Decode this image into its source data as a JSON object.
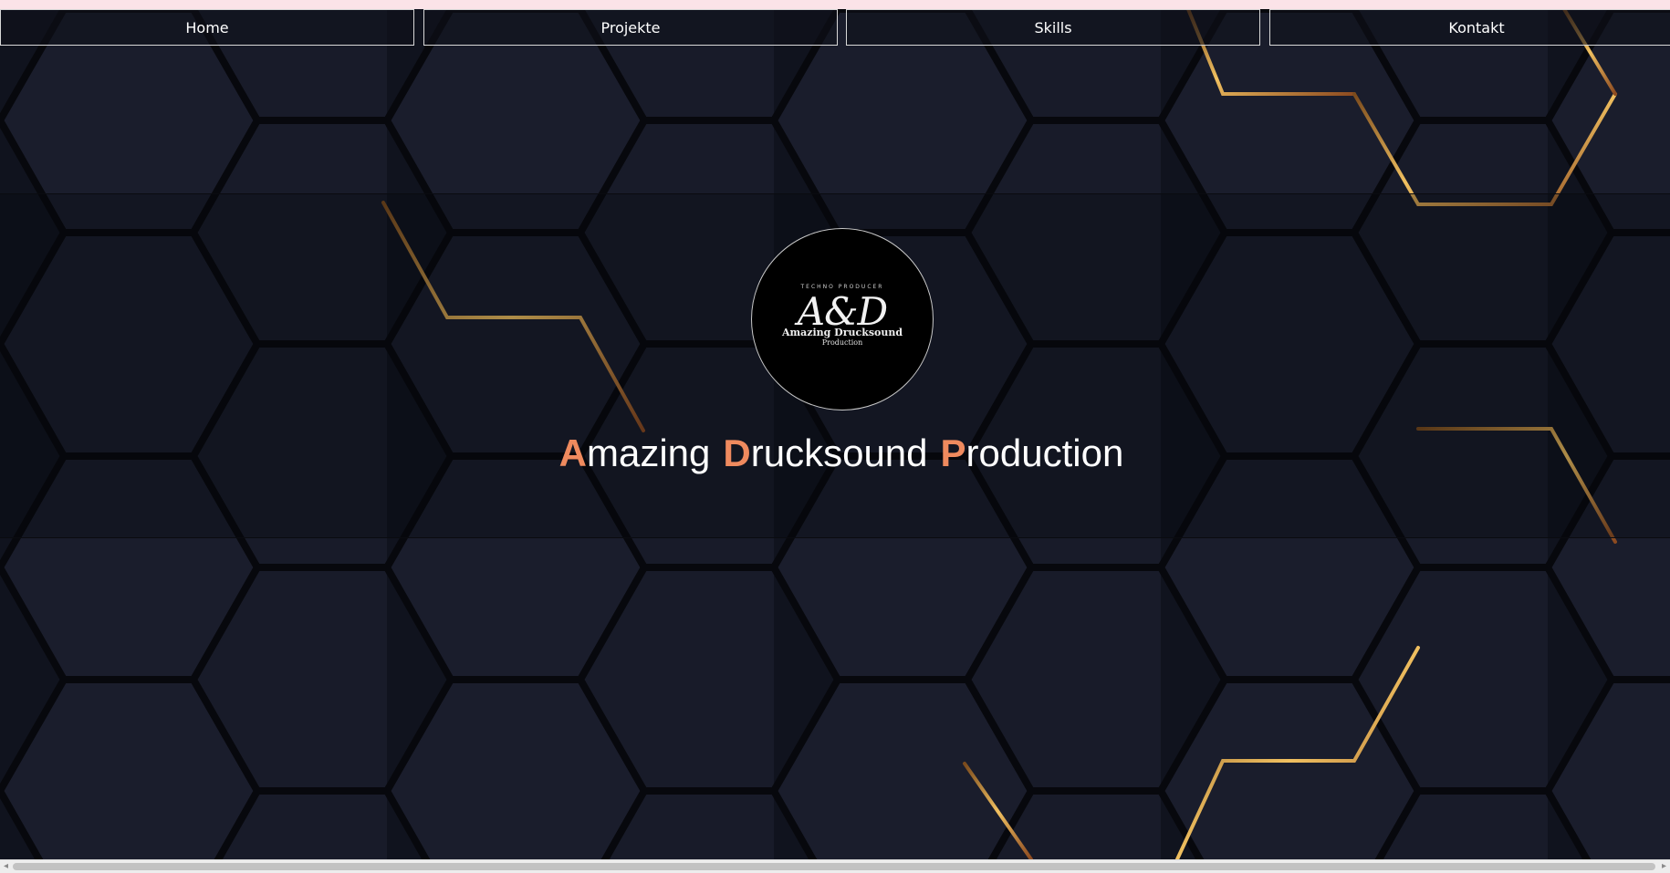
{
  "nav": {
    "items": [
      {
        "label": "Home"
      },
      {
        "label": "Projekte"
      },
      {
        "label": "Skills"
      },
      {
        "label": "Kontakt"
      }
    ]
  },
  "logo": {
    "tagline": "TECHNO PRODUCER",
    "mark": "A&D",
    "name": "Amazing Drucksound",
    "sub": "Production"
  },
  "hero": {
    "title": [
      {
        "initial": "A",
        "rest": "mazing"
      },
      {
        "initial": "D",
        "rest": "rucksound"
      },
      {
        "initial": "P",
        "rest": "roduction"
      }
    ]
  },
  "colors": {
    "accent": "#ef8a5e",
    "background": "#151826",
    "hex_edge": "#0b0d16",
    "gold": "#d9a441"
  },
  "icons": {
    "scroll_left": "scroll-left-arrow-icon",
    "scroll_right": "scroll-right-arrow-icon"
  }
}
